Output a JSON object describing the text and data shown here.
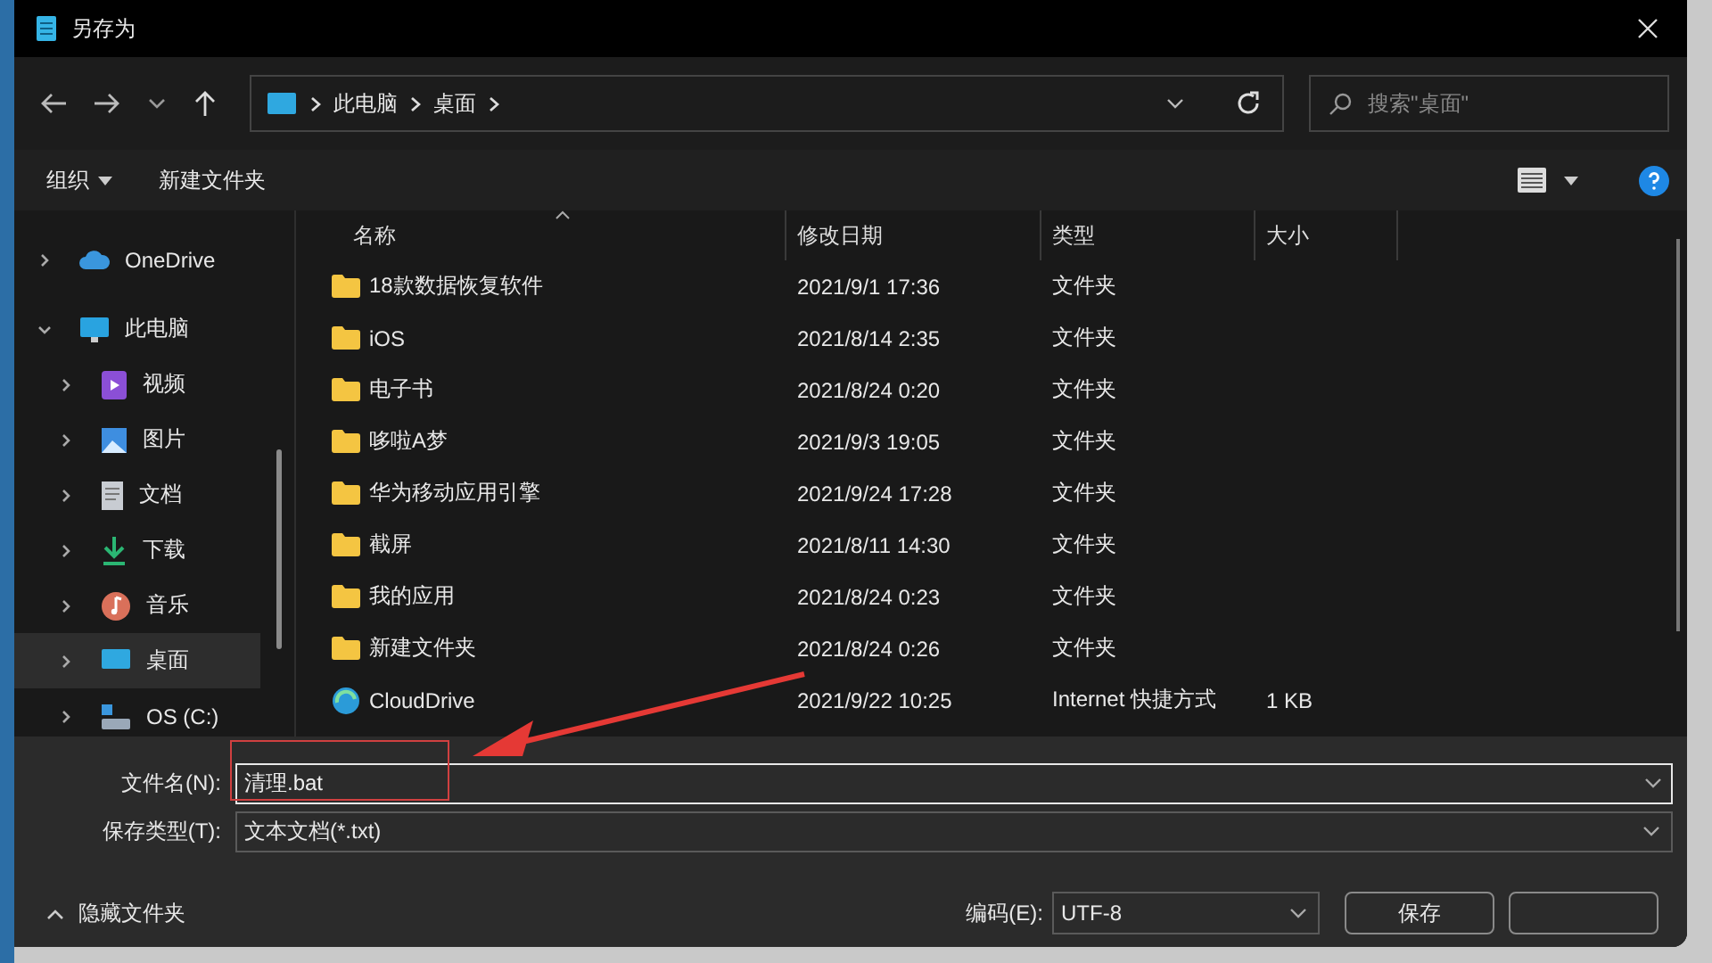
{
  "window": {
    "title": "另存为"
  },
  "address": {
    "crumbs": [
      "此电脑",
      "桌面"
    ],
    "search_placeholder": "搜索\"桌面\""
  },
  "commands": [
    {
      "label": "组织",
      "dropdown": true
    },
    {
      "label": "新建文件夹",
      "dropdown": false
    }
  ],
  "sidebar": {
    "items": [
      {
        "label": "OneDrive",
        "kind": "cloud",
        "expanded": false,
        "selected": false
      },
      {
        "label": "此电脑",
        "kind": "computer",
        "expanded": true,
        "selected": false,
        "children": [
          {
            "label": "视频",
            "kind": "videos",
            "expanded": false,
            "selected": false
          },
          {
            "label": "图片",
            "kind": "pictures",
            "expanded": false,
            "selected": false
          },
          {
            "label": "文档",
            "kind": "documents",
            "expanded": false,
            "selected": false
          },
          {
            "label": "下载",
            "kind": "downloads",
            "expanded": false,
            "selected": false
          },
          {
            "label": "音乐",
            "kind": "music",
            "expanded": false,
            "selected": false
          },
          {
            "label": "桌面",
            "kind": "desktop",
            "expanded": false,
            "selected": true
          },
          {
            "label": "OS (C:)",
            "kind": "drive",
            "expanded": false,
            "selected": false
          }
        ]
      }
    ]
  },
  "table": {
    "columns": [
      {
        "label": "名称",
        "sorted": true
      },
      {
        "label": "修改日期",
        "sorted": false
      },
      {
        "label": "类型",
        "sorted": false
      },
      {
        "label": "大小",
        "sorted": false
      }
    ],
    "rows": [
      {
        "kind": "folder",
        "name": "18款数据恢复软件",
        "date": "2021/9/1 17:36",
        "type": "文件夹",
        "size": ""
      },
      {
        "kind": "folder",
        "name": "iOS",
        "date": "2021/8/14 2:35",
        "type": "文件夹",
        "size": ""
      },
      {
        "kind": "folder",
        "name": "电子书",
        "date": "2021/8/24 0:20",
        "type": "文件夹",
        "size": ""
      },
      {
        "kind": "folder",
        "name": "哆啦A梦",
        "date": "2021/9/3 19:05",
        "type": "文件夹",
        "size": ""
      },
      {
        "kind": "folder",
        "name": "华为移动应用引擎",
        "date": "2021/9/24 17:28",
        "type": "文件夹",
        "size": ""
      },
      {
        "kind": "folder",
        "name": "截屏",
        "date": "2021/8/11 14:30",
        "type": "文件夹",
        "size": ""
      },
      {
        "kind": "folder",
        "name": "我的应用",
        "date": "2021/8/24 0:23",
        "type": "文件夹",
        "size": ""
      },
      {
        "kind": "folder",
        "name": "新建文件夹",
        "date": "2021/8/24 0:26",
        "type": "文件夹",
        "size": ""
      },
      {
        "kind": "shortcut",
        "name": "CloudDrive",
        "date": "2021/9/22 10:25",
        "type": "Internet 快捷方式",
        "size": "1 KB"
      }
    ]
  },
  "filename": {
    "label": "文件名(N):",
    "value": "清理.bat"
  },
  "savetype": {
    "label": "保存类型(T):",
    "value": "文本文档(*.txt)"
  },
  "hide_folders": "隐藏文件夹",
  "encoding": {
    "label": "编码(E):",
    "value": "UTF-8"
  },
  "buttons": [
    "保存"
  ]
}
